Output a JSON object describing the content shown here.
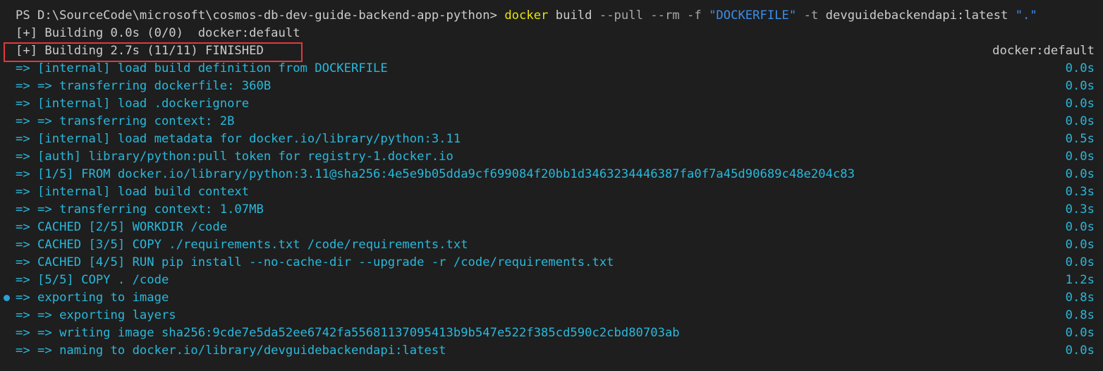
{
  "prompt": {
    "prefix": "PS D:\\SourceCode\\microsoft\\cosmos-db-dev-guide-backend-app-python> ",
    "command": "docker",
    "args": [
      {
        "text": " build ",
        "style": "white"
      },
      {
        "text": "--pull --rm -f ",
        "style": "gray"
      },
      {
        "text": "\"DOCKERFILE\"",
        "style": "strblue"
      },
      {
        "text": " -t ",
        "style": "gray"
      },
      {
        "text": "devguidebackendapi:latest ",
        "style": "white"
      },
      {
        "text": "\".\"",
        "style": "strblue"
      }
    ]
  },
  "status_initial": {
    "text": "[+] Building 0.0s (0/0)  docker:default"
  },
  "status_final": {
    "text": "[+] Building 2.7s (11/11) FINISHED",
    "context": "docker:default"
  },
  "steps": [
    {
      "text": "=> [internal] load build definition from DOCKERFILE",
      "time": "0.0s",
      "bullet": false
    },
    {
      "text": "=> => transferring dockerfile: 360B",
      "time": "0.0s",
      "bullet": false
    },
    {
      "text": "=> [internal] load .dockerignore",
      "time": "0.0s",
      "bullet": false
    },
    {
      "text": "=> => transferring context: 2B",
      "time": "0.0s",
      "bullet": false
    },
    {
      "text": "=> [internal] load metadata for docker.io/library/python:3.11",
      "time": "0.5s",
      "bullet": false
    },
    {
      "text": "=> [auth] library/python:pull token for registry-1.docker.io",
      "time": "0.0s",
      "bullet": false
    },
    {
      "text": "=> [1/5] FROM docker.io/library/python:3.11@sha256:4e5e9b05dda9cf699084f20bb1d3463234446387fa0f7a45d90689c48e204c83",
      "time": "0.0s",
      "bullet": false
    },
    {
      "text": "=> [internal] load build context",
      "time": "0.3s",
      "bullet": false
    },
    {
      "text": "=> => transferring context: 1.07MB",
      "time": "0.3s",
      "bullet": false
    },
    {
      "text": "=> CACHED [2/5] WORKDIR /code",
      "time": "0.0s",
      "bullet": false
    },
    {
      "text": "=> CACHED [3/5] COPY ./requirements.txt /code/requirements.txt",
      "time": "0.0s",
      "bullet": false
    },
    {
      "text": "=> CACHED [4/5] RUN pip install --no-cache-dir --upgrade -r /code/requirements.txt",
      "time": "0.0s",
      "bullet": false
    },
    {
      "text": "=> [5/5] COPY . /code",
      "time": "1.2s",
      "bullet": false
    },
    {
      "text": "=> exporting to image",
      "time": "0.8s",
      "bullet": true
    },
    {
      "text": "=> => exporting layers",
      "time": "0.8s",
      "bullet": false
    },
    {
      "text": "=> => writing image sha256:9cde7e5da52ee6742fa55681137095413b9b547e522f385cd590c2cbd80703ab",
      "time": "0.0s",
      "bullet": false
    },
    {
      "text": "=> => naming to docker.io/library/devguidebackendapi:latest",
      "time": "0.0s",
      "bullet": false
    }
  ],
  "colors": {
    "background": "#1e1e1e",
    "foreground": "#cccccc",
    "command": "#e5e510",
    "string": "#3b8eea",
    "step": "#29b8db",
    "highlight_border": "#e0393e"
  }
}
